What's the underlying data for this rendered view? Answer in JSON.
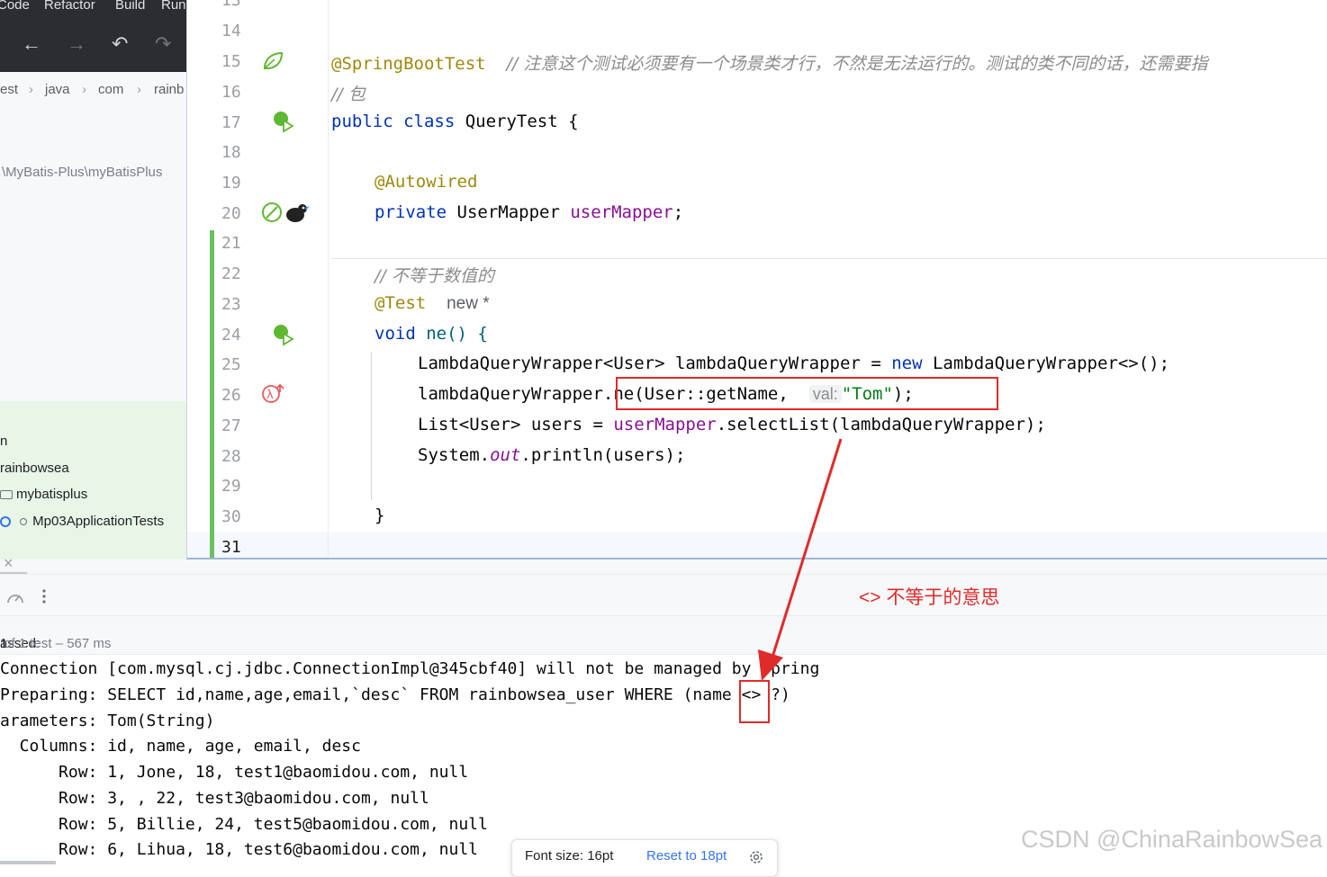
{
  "menu": [
    "Code",
    "Refactor",
    "Build",
    "Run"
  ],
  "toolbar": {
    "back_icon": "←",
    "forward_icon": "→",
    "undo_icon": "↶",
    "redo_icon": "↷"
  },
  "breadcrumb": {
    "items": [
      "est",
      "java",
      "com",
      "rainb"
    ],
    "sep": "›"
  },
  "project": {
    "path": "\\MyBatis-Plus\\myBatisPlus",
    "tree_n": "n",
    "tree_rainbowsea": "rainbowsea",
    "tree_mybatisplus": "mybatisplus",
    "tree_tests": "Mp03ApplicationTests"
  },
  "editor": {
    "top_partial": "13",
    "line_numbers": [
      "14",
      "15",
      "16",
      "17",
      "18",
      "19",
      "20",
      "21",
      "22",
      "23",
      "24",
      "25",
      "26",
      "27",
      "28",
      "29",
      "30",
      "31"
    ],
    "l15_ann": "@SpringBootTest",
    "l15_cmt": "// 注意这个测试必须要有一个场景类才行，不然是无法运行的。测试的类不同的话，还需要指",
    "l16_cmt": "// 包",
    "l17_kw": "public class ",
    "l17_name": "QueryTest {",
    "l19_ann": "@Autowired",
    "l20_kw": "private ",
    "l20_type": "UserMapper ",
    "l20_field": "userMapper",
    "l20_end": ";",
    "l22_cmt": "// 不等于数值的",
    "l23_ann": "@Test",
    "l23_new": "new *",
    "l24_kw": "void ",
    "l24_rest": "ne() {",
    "l25_a": "LambdaQueryWrapper<User> lambdaQueryWrapper = ",
    "l25_kw": "new ",
    "l25_b": "LambdaQueryWrapper<>();",
    "l26_a": "lambdaQueryWrapper.ne(User::getName, ",
    "l26_hint": "val:",
    "l26_str": "\"Tom\"",
    "l26_end": ");",
    "l27_a": "List<User> users = ",
    "l27_field": "userMapper",
    "l27_b": ".selectList(lambdaQueryWrapper);",
    "l28_a": "System.",
    "l28_out": "out",
    "l28_b": ".println(users);",
    "l30": "}"
  },
  "run": {
    "passed_prefix": "assed: ",
    "passed_count": "1",
    "passed_rest": " of 1 test – 567 ms",
    "console": [
      "Connection [com.mysql.cj.jdbc.ConnectionImpl@345cbf40] will not be managed by Spring",
      "Preparing: SELECT id,name,age,email,`desc` FROM rainbowsea_user WHERE (name <> ?)",
      "arameters: Tom(String)",
      "  Columns: id, name, age, email, desc",
      "      Row: 1, Jone, 18, test1@baomidou.com, null",
      "      Row: 3, , 22, test3@baomidou.com, null",
      "      Row: 5, Billie, 24, test5@baomidou.com, null",
      "      Row: 6, Lihua, 18, test6@baomidou.com, null"
    ]
  },
  "annotation": "<> 不等于的意思",
  "popup": {
    "font_size": "Font size: 16pt",
    "reset": "Reset to 18pt"
  },
  "watermark": "CSDN @ChinaRainbowSea",
  "colors": {
    "highlight_red": "#e02b2b",
    "keyword": "#0033b3",
    "annotation": "#9e880d",
    "string": "#067d17",
    "field": "#871094"
  }
}
